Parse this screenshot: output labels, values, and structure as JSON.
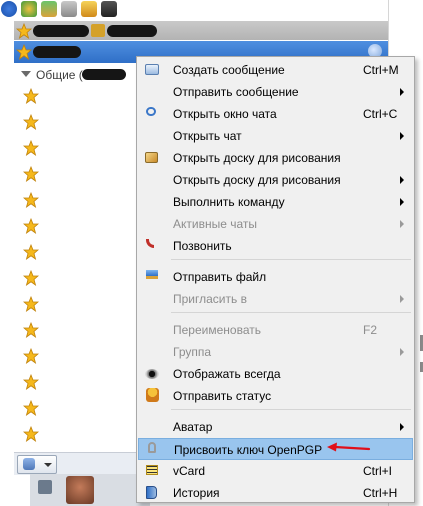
{
  "toolbar": {
    "icons": [
      "info-icon",
      "users-icon",
      "network-icon",
      "tools-icon",
      "alert-icon",
      "monitor-icon"
    ]
  },
  "contacts": {
    "group_label": "Общие (",
    "star_rows": 14
  },
  "menu": {
    "items": [
      {
        "label": "Создать сообщение",
        "shortcut": "Ctrl+M",
        "icon": "envelope-icon",
        "submenu": false,
        "disabled": false
      },
      {
        "label": "Отправить сообщение",
        "shortcut": "",
        "icon": "",
        "submenu": true,
        "disabled": false
      },
      {
        "label": "Открыть окно чата",
        "shortcut": "Ctrl+C",
        "icon": "chat-bubble-icon",
        "submenu": false,
        "disabled": false
      },
      {
        "label": "Открыть чат",
        "shortcut": "",
        "icon": "",
        "submenu": true,
        "disabled": false
      },
      {
        "label": "Открыть доску для рисования",
        "shortcut": "",
        "icon": "whiteboard-icon",
        "submenu": false,
        "disabled": false
      },
      {
        "label": "Открыть доску для рисования",
        "shortcut": "",
        "icon": "",
        "submenu": true,
        "disabled": false
      },
      {
        "label": "Выполнить команду",
        "shortcut": "",
        "icon": "",
        "submenu": true,
        "disabled": false
      },
      {
        "label": "Активные чаты",
        "shortcut": "",
        "icon": "",
        "submenu": true,
        "disabled": true
      },
      {
        "label": "Позвонить",
        "shortcut": "",
        "icon": "phone-icon",
        "submenu": false,
        "disabled": false
      },
      {
        "label": "Отправить файл",
        "shortcut": "",
        "icon": "upload-file-icon",
        "submenu": false,
        "disabled": false
      },
      {
        "label": "Пригласить в",
        "shortcut": "",
        "icon": "",
        "submenu": true,
        "disabled": true
      },
      {
        "label": "Переименовать",
        "shortcut": "F2",
        "icon": "",
        "submenu": false,
        "disabled": true
      },
      {
        "label": "Группа",
        "shortcut": "",
        "icon": "",
        "submenu": true,
        "disabled": true
      },
      {
        "label": "Отображать всегда",
        "shortcut": "",
        "icon": "eye-icon",
        "submenu": false,
        "disabled": false
      },
      {
        "label": "Отправить статус",
        "shortcut": "",
        "icon": "status-user-icon",
        "submenu": false,
        "disabled": false
      },
      {
        "label": "Аватар",
        "shortcut": "",
        "icon": "",
        "submenu": true,
        "disabled": false
      },
      {
        "label": "Присвоить ключ OpenPGP",
        "shortcut": "",
        "icon": "key-icon",
        "submenu": false,
        "disabled": false,
        "highlighted": true
      },
      {
        "label": "vCard",
        "shortcut": "Ctrl+I",
        "icon": "vcard-icon",
        "submenu": false,
        "disabled": false
      },
      {
        "label": "История",
        "shortcut": "Ctrl+H",
        "icon": "history-book-icon",
        "submenu": false,
        "disabled": false
      }
    ]
  },
  "colors": {
    "highlight": "#99c5ee",
    "selection": "#3b7bd4",
    "annotation_arrow": "#e0101a"
  }
}
